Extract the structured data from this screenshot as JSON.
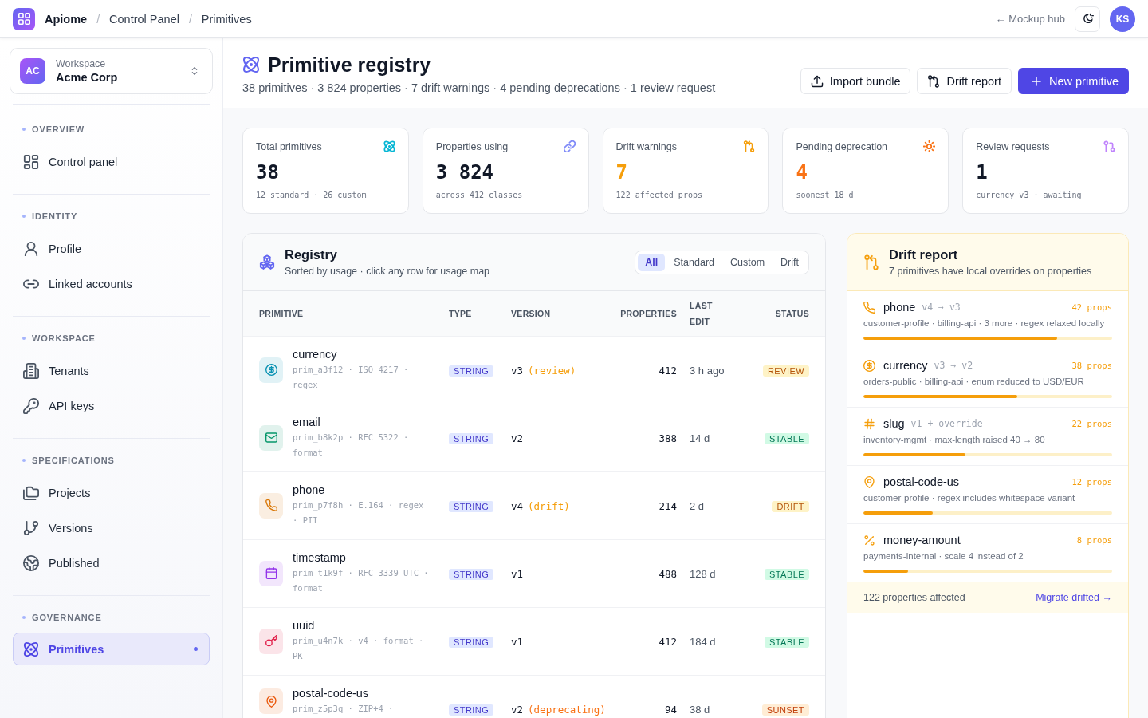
{
  "topbar": {
    "breadcrumbs": [
      "Apiome",
      "Control Panel",
      "Primitives"
    ],
    "separator": "/",
    "hub_link": "← Mockup hub",
    "avatar": "KS"
  },
  "sidebar": {
    "workspace": {
      "initials": "AC",
      "label": "Workspace",
      "name": "Acme Corp"
    },
    "sections": [
      {
        "title": "OVERVIEW",
        "items": [
          {
            "label": "Control panel",
            "selected": false
          }
        ]
      },
      {
        "title": "IDENTITY",
        "items": [
          {
            "label": "Profile",
            "selected": false
          },
          {
            "label": "Linked accounts",
            "selected": false
          }
        ]
      },
      {
        "title": "WORKSPACE",
        "items": [
          {
            "label": "Tenants",
            "selected": false
          },
          {
            "label": "API keys",
            "selected": false
          }
        ]
      },
      {
        "title": "SPECIFICATIONS",
        "items": [
          {
            "label": "Projects",
            "selected": false
          },
          {
            "label": "Versions",
            "selected": false
          },
          {
            "label": "Published",
            "selected": false
          }
        ]
      },
      {
        "title": "GOVERNANCE",
        "items": [
          {
            "label": "Primitives",
            "selected": true
          }
        ]
      }
    ]
  },
  "header": {
    "title": "Primitive registry",
    "summary": "38 primitives · 3 824 properties · 7 drift warnings · 4 pending deprecations · 1 review request",
    "buttons": [
      {
        "label": "Import bundle",
        "kind": "secondary"
      },
      {
        "label": "Drift report",
        "kind": "secondary"
      },
      {
        "label": "New primitive",
        "kind": "primary"
      }
    ]
  },
  "stats": [
    {
      "label": "Total primitives",
      "value": "38",
      "detail": "12 standard · 26 custom",
      "color": "#06b6d4",
      "highlight": false
    },
    {
      "label": "Properties using",
      "value": "3 824",
      "detail": "across 412 classes",
      "color": "#818cf8",
      "highlight": false
    },
    {
      "label": "Drift warnings",
      "value": "7",
      "detail": "122 affected props",
      "color": "#f59e0b",
      "highlight": true
    },
    {
      "label": "Pending deprecation",
      "value": "4",
      "detail": "soonest 18 d",
      "color": "#f97316",
      "highlight": true
    },
    {
      "label": "Review requests",
      "value": "1",
      "detail": "currency v3 · awaiting",
      "color": "#c084fc",
      "highlight": false
    }
  ],
  "registry": {
    "title": "Registry",
    "subtitle": "Sorted by usage · click any row for usage map",
    "filters": [
      {
        "label": "All",
        "selected": true
      },
      {
        "label": "Standard",
        "selected": false
      },
      {
        "label": "Custom",
        "selected": false
      },
      {
        "label": "Drift",
        "selected": false
      }
    ],
    "columns": [
      "PRIMITIVE",
      "TYPE",
      "VERSION",
      "PROPERTIES",
      "LAST EDIT",
      "STATUS"
    ],
    "rows": [
      {
        "name": "currency",
        "meta": "prim_a3f12 · ISO 4217 · regex",
        "color": "#0891b2",
        "type": "STRING",
        "version": "v3",
        "version_note": "(review)",
        "properties": "412",
        "last_edit": "3 h ago",
        "status": {
          "label": "REVIEW",
          "kind": "review"
        }
      },
      {
        "name": "email",
        "meta": "prim_b8k2p · RFC 5322 · format",
        "color": "#059669",
        "type": "STRING",
        "version": "v2",
        "properties": "388",
        "last_edit": "14 d",
        "status": {
          "label": "STABLE",
          "kind": "stable"
        }
      },
      {
        "name": "phone",
        "meta": "prim_p7f8h · E.164 · regex · PII",
        "color": "#d97706",
        "type": "STRING",
        "version": "v4",
        "version_note": "(drift)",
        "properties": "214",
        "last_edit": "2 d",
        "status": {
          "label": "DRIFT",
          "kind": "drift"
        }
      },
      {
        "name": "timestamp",
        "meta": "prim_t1k9f · RFC 3339 UTC · format",
        "color": "#9333ea",
        "type": "STRING",
        "version": "v1",
        "properties": "488",
        "last_edit": "128 d",
        "status": {
          "label": "STABLE",
          "kind": "stable"
        }
      },
      {
        "name": "uuid",
        "meta": "prim_u4n7k · v4 · format · PK",
        "color": "#e11d48",
        "type": "STRING",
        "version": "v1",
        "properties": "412",
        "last_edit": "184 d",
        "status": {
          "label": "STABLE",
          "kind": "stable"
        }
      },
      {
        "name": "postal-code-us",
        "meta": "prim_z5p3q · ZIP+4 ·",
        "color": "#ea580c",
        "type": "STRING",
        "version": "v2",
        "version_note": "(deprecating)",
        "properties": "94",
        "last_edit": "38 d",
        "status": {
          "label": "SUNSET",
          "kind": "sunset"
        }
      }
    ]
  },
  "drift_report": {
    "title": "Drift report",
    "subtitle": "7 primitives have local overrides on properties",
    "items": [
      {
        "name": "phone",
        "change": "v4 → v3",
        "count": "42 props",
        "detail": "customer-profile · billing-api · 3 more · regex relaxed locally",
        "level": 0.78
      },
      {
        "name": "currency",
        "change": "v3 → v2",
        "count": "38 props",
        "detail": "orders-public · billing-api · enum reduced to USD/EUR",
        "level": 0.62
      },
      {
        "name": "slug",
        "change": "v1 + override",
        "count": "22 props",
        "detail": "inventory-mgmt · max-length raised 40 → 80",
        "level": 0.41
      },
      {
        "name": "postal-code-us",
        "count": "12 props",
        "detail": "customer-profile · regex includes whitespace variant",
        "level": 0.28
      },
      {
        "name": "money-amount",
        "count": "8 props",
        "detail": "payments-internal · scale 4 instead of 2",
        "level": 0.18
      }
    ],
    "footer": {
      "summary": "122 properties affected",
      "link": "Migrate drifted →"
    }
  }
}
